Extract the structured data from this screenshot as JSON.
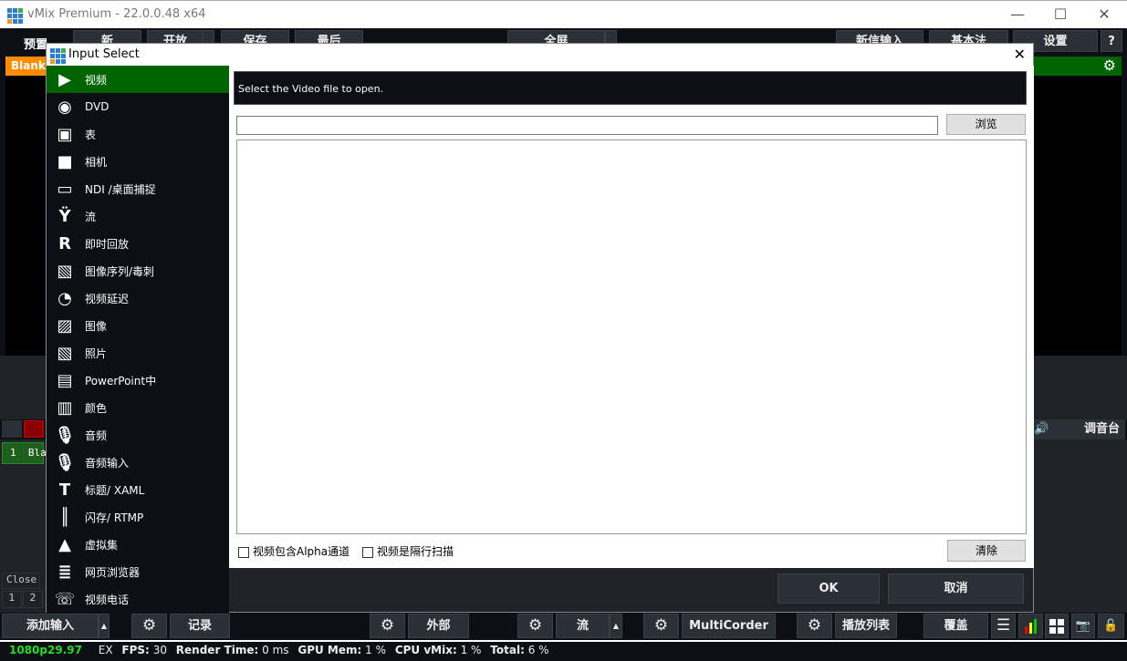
{
  "window": {
    "title": "vMix Premium - 22.0.0.48 x64",
    "minimize": "—",
    "maximize": "☐",
    "close": "✕"
  },
  "toolbar": {
    "preset": "预置",
    "new": "新",
    "open": "开放",
    "save": "保存",
    "last": "最后",
    "fullscreen": "全屏",
    "new_input": "新信输入",
    "basic": "基本法",
    "settings": "设置",
    "help": "?"
  },
  "preview": {
    "label": "Blank"
  },
  "behind": {
    "input_number": "1",
    "input_name": "Bla",
    "close": "Close",
    "n1": "1",
    "n2": "2",
    "mixer": "调音台"
  },
  "dialog": {
    "title": "Input Select",
    "close": "✕",
    "items": [
      {
        "label": "视频",
        "icon": "film-icon"
      },
      {
        "label": "DVD",
        "icon": "disc-icon"
      },
      {
        "label": "表",
        "icon": "list-icon"
      },
      {
        "label": "相机",
        "icon": "camera-icon"
      },
      {
        "label": "NDI /桌面捕捉",
        "icon": "monitor-icon"
      },
      {
        "label": "流",
        "icon": "antenna-icon"
      },
      {
        "label": "即时回放",
        "icon": "replay-icon"
      },
      {
        "label": "图像序列/毒刺",
        "icon": "image-sequence-icon"
      },
      {
        "label": "视频延迟",
        "icon": "clock-icon"
      },
      {
        "label": "图像",
        "icon": "image-icon"
      },
      {
        "label": "照片",
        "icon": "photos-icon"
      },
      {
        "label": "PowerPoint中",
        "icon": "presentation-icon"
      },
      {
        "label": "颜色",
        "icon": "color-icon"
      },
      {
        "label": "音频",
        "icon": "microphone-icon"
      },
      {
        "label": "音频输入",
        "icon": "microphone-icon"
      },
      {
        "label": "标题/ XAML",
        "icon": "title-icon"
      },
      {
        "label": "闪存/ RTMP",
        "icon": "waveform-icon"
      },
      {
        "label": "虚拟集",
        "icon": "virtual-set-icon"
      },
      {
        "label": "网页浏览器",
        "icon": "browser-icon"
      },
      {
        "label": "视频电话",
        "icon": "video-call-icon"
      }
    ],
    "instruction": "Select the Video file to open.",
    "file_value": "",
    "browse": "浏览",
    "alpha_checkbox": "视频包含Alpha通道",
    "interlaced_checkbox": "视频是隔行扫描",
    "clear": "清除",
    "ok": "OK",
    "cancel": "取消"
  },
  "bottom": {
    "add_input": "添加输入",
    "record": "记录",
    "external": "外部",
    "stream": "流",
    "multicorder": "MultiCorder",
    "playlist": "播放列表",
    "overlay": "覆盖"
  },
  "status": {
    "format": "1080p29.97",
    "ex": "EX",
    "fps_label": "FPS:",
    "fps": "30",
    "render_label": "Render Time:",
    "render": "0 ms",
    "gpu_label": "GPU Mem:",
    "gpu": "1 %",
    "cpu_label": "CPU vMix:",
    "cpu": "1 %",
    "total_label": "Total:",
    "total": "6 %"
  },
  "colors": {
    "accent_green": "#006400",
    "preview_orange": "#ff8c00",
    "format_green": "#22dd22"
  }
}
